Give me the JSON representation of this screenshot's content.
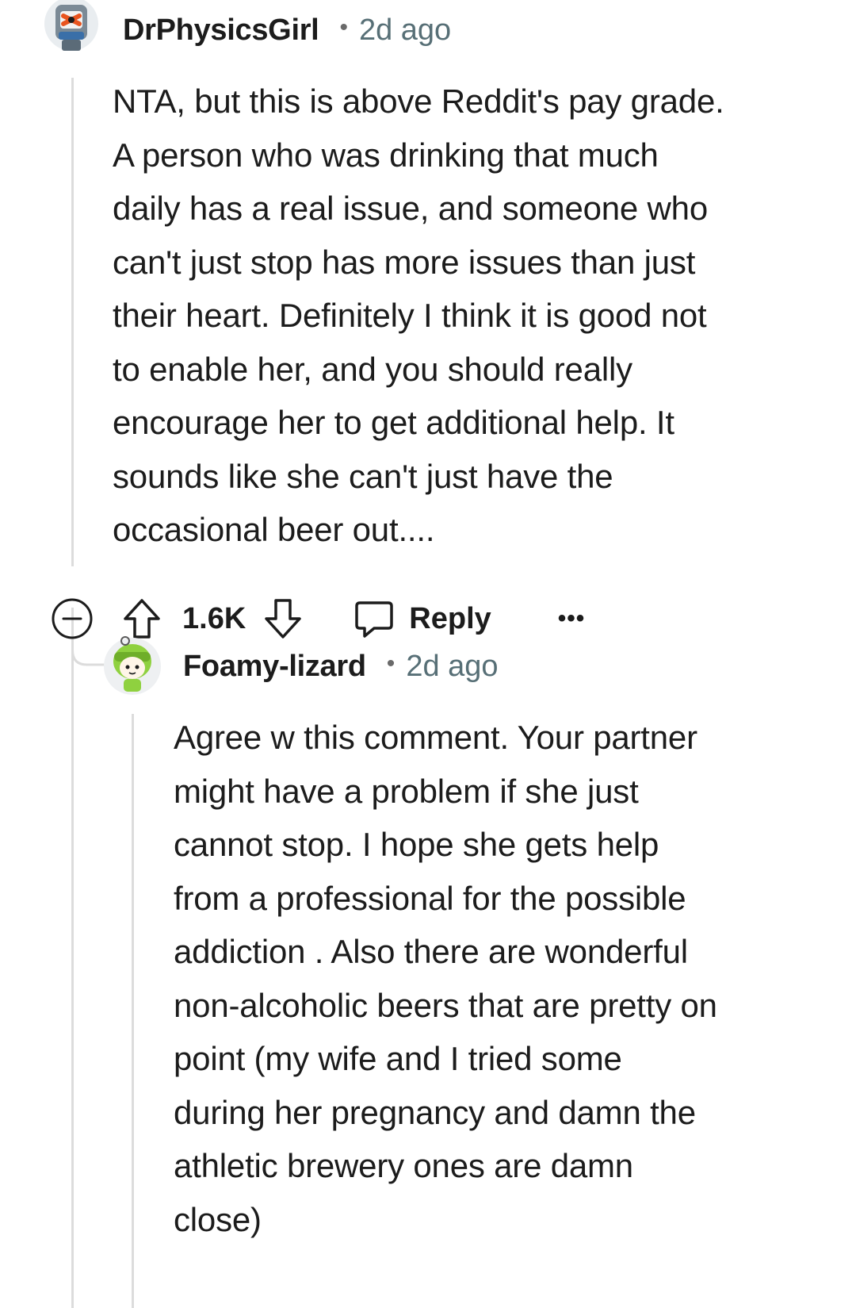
{
  "comment": {
    "author": "DrPhysicsGirl",
    "separator": "•",
    "timestamp": "2d ago",
    "body": "NTA, but this is above Reddit's pay grade.\nA person who was drinking that much\ndaily has a real issue, and someone who\ncan't just stop has more issues than just\ntheir heart. Definitely I think it is good not\nto enable her, and you should really\nencourage her to get additional help. It\nsounds like she can't just have the\noccasional beer out....",
    "score": "1.6K",
    "reply_label": "Reply",
    "more_label": "•••"
  },
  "reply": {
    "author": "Foamy-lizard",
    "separator": "•",
    "timestamp": "2d ago",
    "body": "Agree w this comment. Your partner\nmight have a problem if she just\ncannot stop. I hope she gets help\nfrom a professional for the possible\naddiction . Also there are wonderful\nnon-alcoholic beers that are pretty on\npoint (my wife and I tried some\nduring her pregnancy and damn the\nathletic brewery ones are damn\nclose)"
  },
  "colors": {
    "text": "#1c1c1c",
    "meta": "#576f76",
    "thread_line": "#dcdcdc",
    "avatar_green": "#8fd13f"
  },
  "icons": [
    "collapse-icon",
    "upvote-icon",
    "downvote-icon",
    "reply-icon",
    "more-options-icon"
  ]
}
